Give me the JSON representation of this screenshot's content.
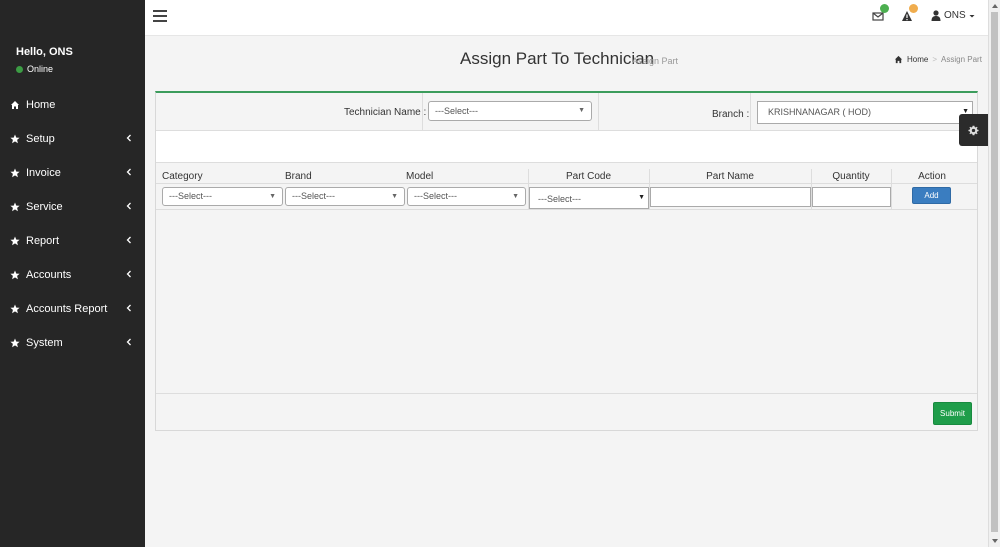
{
  "sidebar": {
    "greeting": "Hello, ONS",
    "status": "Online",
    "items": [
      {
        "label": "Home",
        "has_children": false
      },
      {
        "label": "Setup",
        "has_children": true
      },
      {
        "label": "Invoice",
        "has_children": true
      },
      {
        "label": "Service",
        "has_children": true
      },
      {
        "label": "Report",
        "has_children": true
      },
      {
        "label": "Accounts",
        "has_children": true
      },
      {
        "label": "Accounts Report",
        "has_children": true
      },
      {
        "label": "System",
        "has_children": true
      }
    ]
  },
  "topbar": {
    "icons": [
      "menu-icon",
      "envelope-icon",
      "alert-icon",
      "user-icon"
    ],
    "badge_colors": {
      "mail": "#4caf50",
      "alert": "#f0ad4e"
    },
    "user_name": "ONS"
  },
  "header": {
    "title": "Assign Part To Technician",
    "subtitle": "Assign Part",
    "breadcrumb": {
      "home": "Home",
      "separator": ">",
      "current": "Assign Part"
    }
  },
  "filters": {
    "technician_label": "Technician Name :",
    "technician_value": "---Select---",
    "branch_label": "Branch :",
    "branch_value": "KRISHNANAGAR ( HOD)"
  },
  "table": {
    "columns": [
      "Category",
      "Brand",
      "Model",
      "Part Code",
      "Part Name",
      "Quantity",
      "Action"
    ],
    "row": {
      "category": "---Select---",
      "brand": "---Select---",
      "model": "---Select---",
      "part_code": "---Select---",
      "part_name": "",
      "quantity": "",
      "action_label": "Add"
    }
  },
  "footer": {
    "submit_label": "Submit"
  },
  "colors": {
    "sidebar_bg": "#262626",
    "accent_green": "#1f9d4a",
    "add_blue": "#3a7dc0",
    "box_top_border": "#3c9c5c"
  }
}
